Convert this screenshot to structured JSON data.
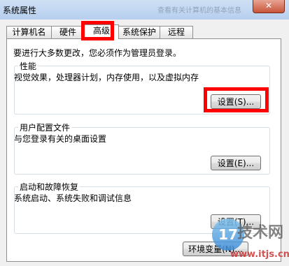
{
  "window": {
    "title": "系统属性",
    "close_glyph": "✕",
    "background_title": "查看有关计算机的基本信息"
  },
  "tabs": [
    {
      "label": "计算机名"
    },
    {
      "label": "硬件"
    },
    {
      "label": "高级",
      "active": true
    },
    {
      "label": "系统保护"
    },
    {
      "label": "远程"
    }
  ],
  "intro": "要进行大多数更改，您必须作为管理员登录。",
  "groups": {
    "performance": {
      "title": "性能",
      "description": "视觉效果，处理器计划，内存使用，以及虚拟内存",
      "button": "设置(S)..."
    },
    "profiles": {
      "title": "用户配置文件",
      "description": "与您登录有关的桌面设置",
      "button": "设置(E)..."
    },
    "startup": {
      "title": "启动和故障恢复",
      "description": "系统启动、系统失败和调试信息",
      "button": "设置(T)..."
    }
  },
  "bottom_button": "环境变量(N)...",
  "colors": {
    "highlight": "#ff0000",
    "titlebar": "#c3d7f0",
    "close_button": "#c7543a"
  },
  "watermark": {
    "number": "17",
    "text": "技术网",
    "url": "www.itjs.cn"
  }
}
